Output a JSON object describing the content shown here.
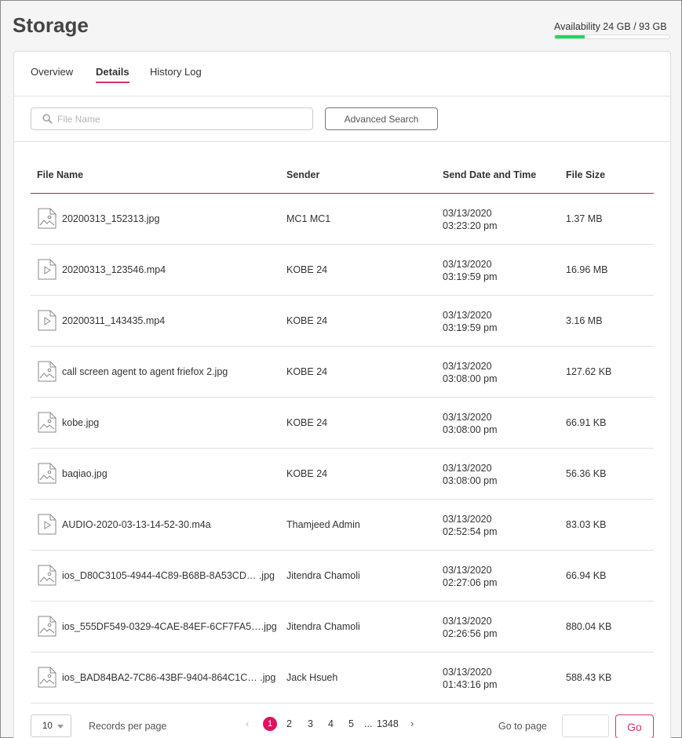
{
  "page": {
    "title": "Storage"
  },
  "availability": {
    "label": "Availability 24 GB / 93 GB",
    "used_fraction": 0.26,
    "bar_color": "#1ed760"
  },
  "tabs": [
    {
      "label": "Overview",
      "active": false
    },
    {
      "label": "Details",
      "active": true
    },
    {
      "label": "History Log",
      "active": false
    }
  ],
  "search": {
    "placeholder": "File Name",
    "value": "",
    "advanced_label": "Advanced Search"
  },
  "table": {
    "headers": {
      "name": "File Name",
      "sender": "Sender",
      "date": "Send Date and Time",
      "size": "File Size"
    },
    "rows": [
      {
        "icon": "image-file-icon",
        "name": "20200313_152313.jpg",
        "sender": "MC1 MC1",
        "date": "03/13/2020",
        "time": "03:23:20 pm",
        "size": "1.37 MB"
      },
      {
        "icon": "video-file-icon",
        "name": "20200313_123546.mp4",
        "sender": "KOBE 24",
        "date": "03/13/2020",
        "time": "03:19:59 pm",
        "size": "16.96 MB"
      },
      {
        "icon": "video-file-icon",
        "name": "20200311_143435.mp4",
        "sender": "KOBE 24",
        "date": "03/13/2020",
        "time": "03:19:59 pm",
        "size": "3.16 MB"
      },
      {
        "icon": "image-file-icon",
        "name": "call screen agent to agent friefox 2.jpg",
        "sender": "KOBE 24",
        "date": "03/13/2020",
        "time": "03:08:00 pm",
        "size": "127.62 KB"
      },
      {
        "icon": "image-file-icon",
        "name": "kobe.jpg",
        "sender": "KOBE 24",
        "date": "03/13/2020",
        "time": "03:08:00 pm",
        "size": "66.91 KB"
      },
      {
        "icon": "image-file-icon",
        "name": "baqiao.jpg",
        "sender": "KOBE 24",
        "date": "03/13/2020",
        "time": "03:08:00 pm",
        "size": "56.36 KB"
      },
      {
        "icon": "audio-file-icon",
        "name": "AUDIO-2020-03-13-14-52-30.m4a",
        "sender": "Thamjeed Admin",
        "date": "03/13/2020",
        "time": "02:52:54 pm",
        "size": "83.03 KB"
      },
      {
        "icon": "image-file-icon",
        "name": "ios_D80C3105-4944-4C89-B68B-8A53CD… .jpg",
        "sender": "Jitendra Chamoli",
        "date": "03/13/2020",
        "time": "02:27:06 pm",
        "size": "66.94 KB"
      },
      {
        "icon": "image-file-icon",
        "name": "ios_555DF549-0329-4CAE-84EF-6CF7FA5….jpg",
        "sender": "Jitendra Chamoli",
        "date": "03/13/2020",
        "time": "02:26:56 pm",
        "size": "880.04 KB"
      },
      {
        "icon": "image-file-icon",
        "name": "ios_BAD84BA2-7C86-43BF-9404-864C1C… .jpg",
        "sender": "Jack Hsueh",
        "date": "03/13/2020",
        "time": "01:43:16 pm",
        "size": "588.43 KB"
      }
    ]
  },
  "pagination": {
    "per_page_value": "10",
    "per_page_label": "Records per page",
    "prev": "‹",
    "pages": [
      "1",
      "2",
      "3",
      "4",
      "5",
      "...",
      "1348"
    ],
    "current": "1",
    "next": "›",
    "goto_label": "Go to page",
    "goto_value": "",
    "go_label": "Go"
  },
  "colors": {
    "accent": "#d6336c",
    "active_page": "#e0115f"
  }
}
